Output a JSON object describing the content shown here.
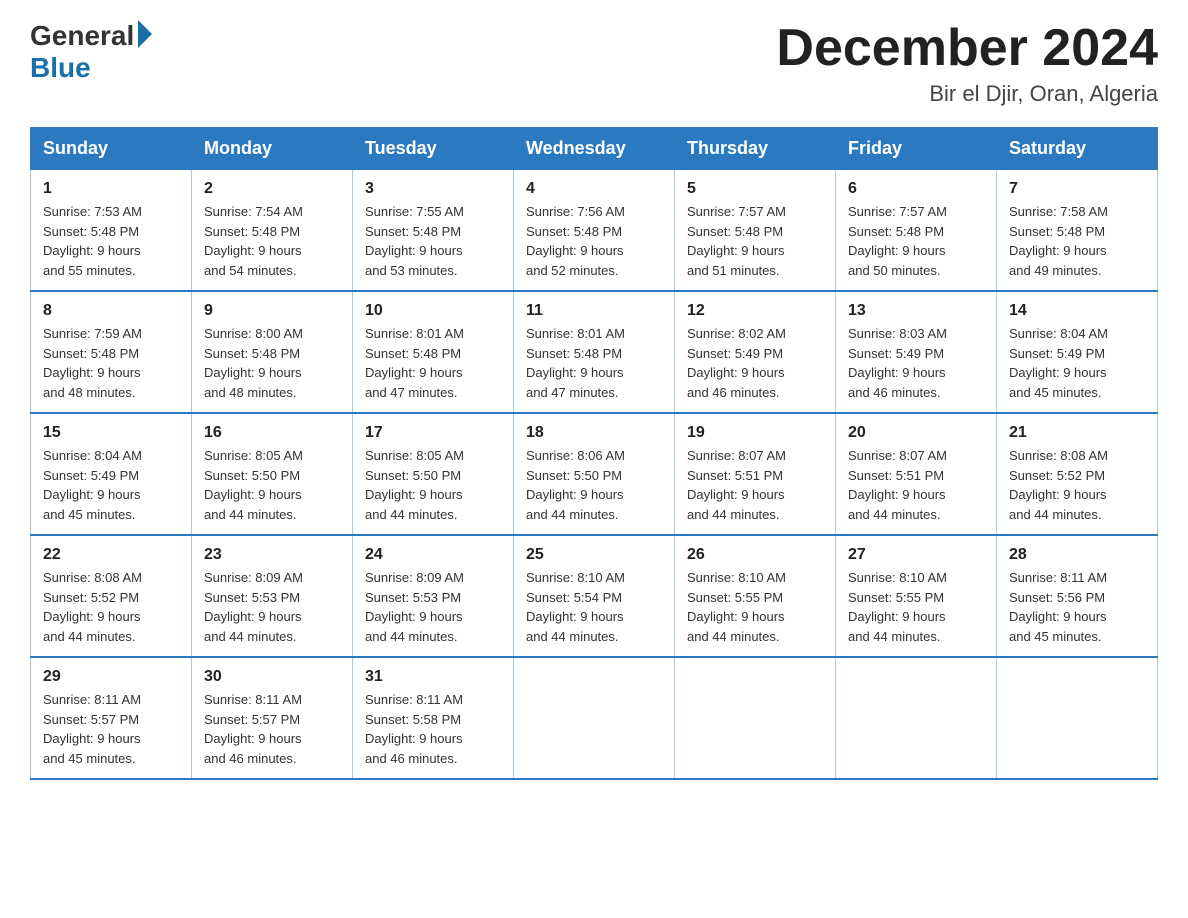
{
  "header": {
    "logo_general": "General",
    "logo_blue": "Blue",
    "month_title": "December 2024",
    "location": "Bir el Djir, Oran, Algeria"
  },
  "days_of_week": [
    "Sunday",
    "Monday",
    "Tuesday",
    "Wednesday",
    "Thursday",
    "Friday",
    "Saturday"
  ],
  "weeks": [
    [
      {
        "day": 1,
        "sunrise": "7:53 AM",
        "sunset": "5:48 PM",
        "daylight": "9 hours and 55 minutes."
      },
      {
        "day": 2,
        "sunrise": "7:54 AM",
        "sunset": "5:48 PM",
        "daylight": "9 hours and 54 minutes."
      },
      {
        "day": 3,
        "sunrise": "7:55 AM",
        "sunset": "5:48 PM",
        "daylight": "9 hours and 53 minutes."
      },
      {
        "day": 4,
        "sunrise": "7:56 AM",
        "sunset": "5:48 PM",
        "daylight": "9 hours and 52 minutes."
      },
      {
        "day": 5,
        "sunrise": "7:57 AM",
        "sunset": "5:48 PM",
        "daylight": "9 hours and 51 minutes."
      },
      {
        "day": 6,
        "sunrise": "7:57 AM",
        "sunset": "5:48 PM",
        "daylight": "9 hours and 50 minutes."
      },
      {
        "day": 7,
        "sunrise": "7:58 AM",
        "sunset": "5:48 PM",
        "daylight": "9 hours and 49 minutes."
      }
    ],
    [
      {
        "day": 8,
        "sunrise": "7:59 AM",
        "sunset": "5:48 PM",
        "daylight": "9 hours and 48 minutes."
      },
      {
        "day": 9,
        "sunrise": "8:00 AM",
        "sunset": "5:48 PM",
        "daylight": "9 hours and 48 minutes."
      },
      {
        "day": 10,
        "sunrise": "8:01 AM",
        "sunset": "5:48 PM",
        "daylight": "9 hours and 47 minutes."
      },
      {
        "day": 11,
        "sunrise": "8:01 AM",
        "sunset": "5:48 PM",
        "daylight": "9 hours and 47 minutes."
      },
      {
        "day": 12,
        "sunrise": "8:02 AM",
        "sunset": "5:49 PM",
        "daylight": "9 hours and 46 minutes."
      },
      {
        "day": 13,
        "sunrise": "8:03 AM",
        "sunset": "5:49 PM",
        "daylight": "9 hours and 46 minutes."
      },
      {
        "day": 14,
        "sunrise": "8:04 AM",
        "sunset": "5:49 PM",
        "daylight": "9 hours and 45 minutes."
      }
    ],
    [
      {
        "day": 15,
        "sunrise": "8:04 AM",
        "sunset": "5:49 PM",
        "daylight": "9 hours and 45 minutes."
      },
      {
        "day": 16,
        "sunrise": "8:05 AM",
        "sunset": "5:50 PM",
        "daylight": "9 hours and 44 minutes."
      },
      {
        "day": 17,
        "sunrise": "8:05 AM",
        "sunset": "5:50 PM",
        "daylight": "9 hours and 44 minutes."
      },
      {
        "day": 18,
        "sunrise": "8:06 AM",
        "sunset": "5:50 PM",
        "daylight": "9 hours and 44 minutes."
      },
      {
        "day": 19,
        "sunrise": "8:07 AM",
        "sunset": "5:51 PM",
        "daylight": "9 hours and 44 minutes."
      },
      {
        "day": 20,
        "sunrise": "8:07 AM",
        "sunset": "5:51 PM",
        "daylight": "9 hours and 44 minutes."
      },
      {
        "day": 21,
        "sunrise": "8:08 AM",
        "sunset": "5:52 PM",
        "daylight": "9 hours and 44 minutes."
      }
    ],
    [
      {
        "day": 22,
        "sunrise": "8:08 AM",
        "sunset": "5:52 PM",
        "daylight": "9 hours and 44 minutes."
      },
      {
        "day": 23,
        "sunrise": "8:09 AM",
        "sunset": "5:53 PM",
        "daylight": "9 hours and 44 minutes."
      },
      {
        "day": 24,
        "sunrise": "8:09 AM",
        "sunset": "5:53 PM",
        "daylight": "9 hours and 44 minutes."
      },
      {
        "day": 25,
        "sunrise": "8:10 AM",
        "sunset": "5:54 PM",
        "daylight": "9 hours and 44 minutes."
      },
      {
        "day": 26,
        "sunrise": "8:10 AM",
        "sunset": "5:55 PM",
        "daylight": "9 hours and 44 minutes."
      },
      {
        "day": 27,
        "sunrise": "8:10 AM",
        "sunset": "5:55 PM",
        "daylight": "9 hours and 44 minutes."
      },
      {
        "day": 28,
        "sunrise": "8:11 AM",
        "sunset": "5:56 PM",
        "daylight": "9 hours and 45 minutes."
      }
    ],
    [
      {
        "day": 29,
        "sunrise": "8:11 AM",
        "sunset": "5:57 PM",
        "daylight": "9 hours and 45 minutes."
      },
      {
        "day": 30,
        "sunrise": "8:11 AM",
        "sunset": "5:57 PM",
        "daylight": "9 hours and 46 minutes."
      },
      {
        "day": 31,
        "sunrise": "8:11 AM",
        "sunset": "5:58 PM",
        "daylight": "9 hours and 46 minutes."
      },
      null,
      null,
      null,
      null
    ]
  ],
  "labels": {
    "sunrise_prefix": "Sunrise: ",
    "sunset_prefix": "Sunset: ",
    "daylight_prefix": "Daylight: "
  }
}
